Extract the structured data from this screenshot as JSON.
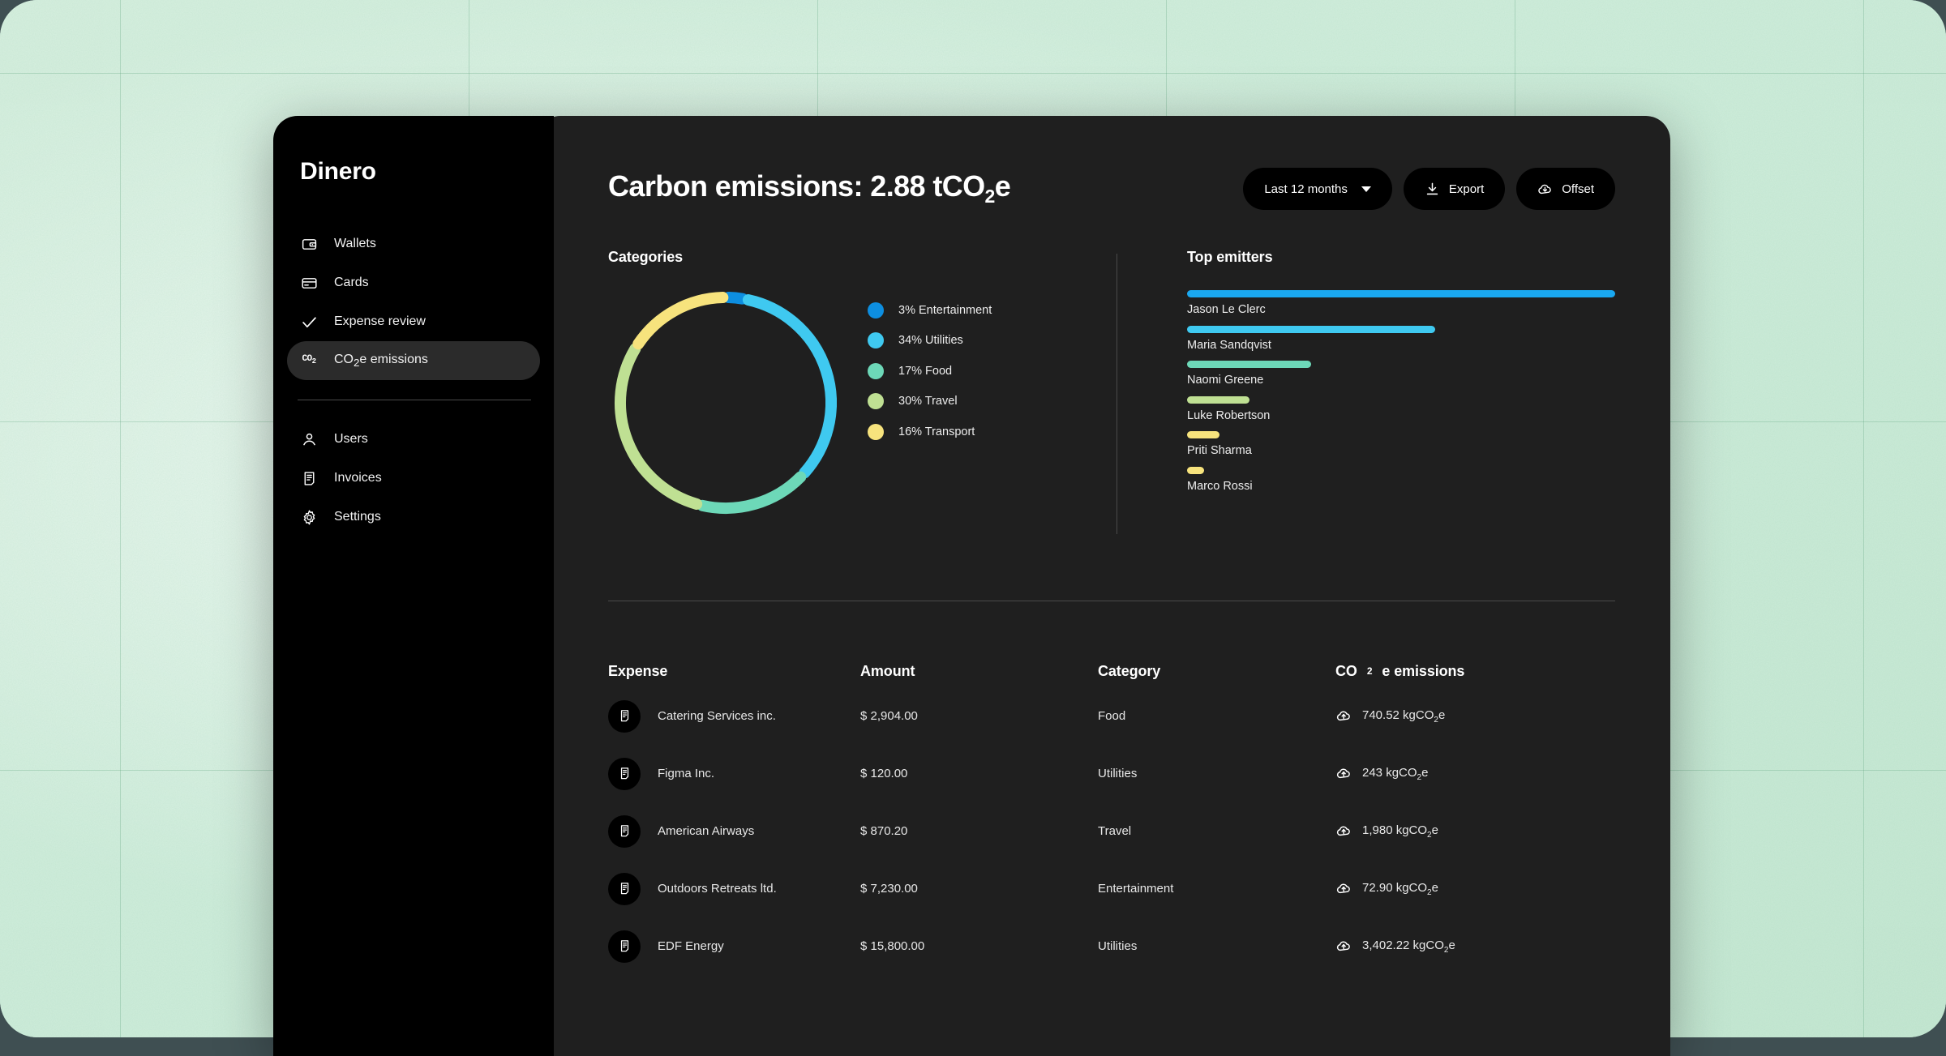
{
  "brand": "Dinero",
  "sidebar": {
    "primary": [
      {
        "label": "Wallets",
        "icon": "wallet-icon",
        "active": false
      },
      {
        "label": "Cards",
        "icon": "card-icon",
        "active": false
      },
      {
        "label": "Expense review",
        "icon": "check-icon",
        "active": false
      },
      {
        "label": "CO₂e emissions",
        "icon": "co2-icon",
        "active": true
      }
    ],
    "secondary": [
      {
        "label": "Users",
        "icon": "user-icon",
        "active": false
      },
      {
        "label": "Invoices",
        "icon": "invoice-icon",
        "active": false
      },
      {
        "label": "Settings",
        "icon": "gear-icon",
        "active": false
      }
    ]
  },
  "header": {
    "title": "Carbon emissions: 2.88 tCO₂e",
    "range_label": "Last 12 months",
    "export_label": "Export",
    "offset_label": "Offset"
  },
  "categories_panel": {
    "title": "Categories"
  },
  "emitters_panel": {
    "title": "Top emitters",
    "items": [
      {
        "name": "Jason Le Clerc",
        "pct": 100,
        "color": "#1aa8f0"
      },
      {
        "name": "Maria Sandqvist",
        "pct": 58,
        "color": "#3fc9f0"
      },
      {
        "name": "Naomi Greene",
        "pct": 29,
        "color": "#6dd8b8"
      },
      {
        "name": "Luke Robertson",
        "pct": 14.5,
        "color": "#bfe093"
      },
      {
        "name": "Priti Sharma",
        "pct": 7.5,
        "color": "#f7e37d"
      },
      {
        "name": "Marco Rossi",
        "pct": 4,
        "color": "#f7e37d"
      }
    ]
  },
  "table": {
    "columns": [
      "Expense",
      "Amount",
      "Category",
      "CO₂e emissions"
    ],
    "rows": [
      {
        "expense": "Catering Services inc.",
        "amount": "$ 2,904.00",
        "category": "Food",
        "emissions": "740.52 kgCO₂e"
      },
      {
        "expense": "Figma Inc.",
        "amount": "$ 120.00",
        "category": "Utilities",
        "emissions": "243 kgCO₂e"
      },
      {
        "expense": "American Airways",
        "amount": "$ 870.20",
        "category": "Travel",
        "emissions": "1,980 kgCO₂e"
      },
      {
        "expense": "Outdoors Retreats ltd.",
        "amount": "$ 7,230.00",
        "category": "Entertainment",
        "emissions": "72.90 kgCO₂e"
      },
      {
        "expense": "EDF Energy",
        "amount": "$ 15,800.00",
        "category": "Utilities",
        "emissions": "3,402.22 kgCO₂e"
      }
    ]
  },
  "chart_data": {
    "type": "pie",
    "title": "Categories",
    "categories": [
      "Entertainment",
      "Utilities",
      "Food",
      "Travel",
      "Transport"
    ],
    "values": [
      3,
      34,
      17,
      30,
      16
    ],
    "unit": "%",
    "labels": [
      "3% Entertainment",
      "34% Utilities",
      "17% Food",
      "30% Travel",
      "16% Transport"
    ],
    "colors": [
      "#0d8ee0",
      "#3fc9f0",
      "#6dd8b8",
      "#bfe093",
      "#f7e37d"
    ],
    "legend": "right",
    "donut": true
  },
  "theme": {
    "backdrop": "#cfeddb",
    "sidebar_bg": "#000000",
    "main_bg": "#1f1f1f",
    "accent_blue": "#0d8ee0",
    "accent_cyan": "#3fc9f0",
    "accent_teal": "#6dd8b8",
    "accent_green": "#bfe093",
    "accent_yellow": "#f7e37d"
  }
}
